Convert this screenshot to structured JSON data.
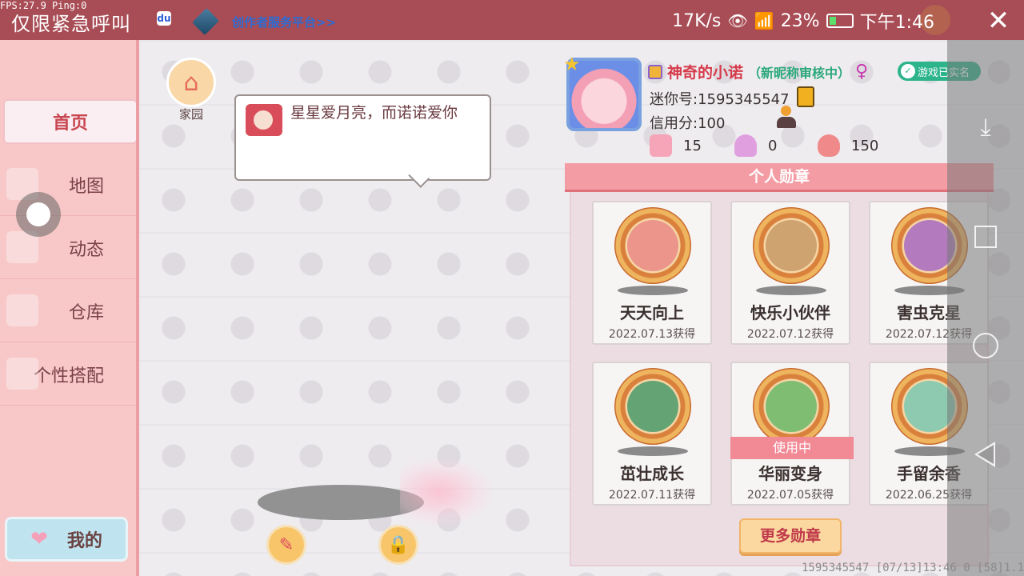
{
  "statusbar": {
    "fps": "FPS:27.9  Ping:0",
    "urgent": "仅限紧急呼叫",
    "creator": "创作者服务平台>>",
    "net_speed": "17K/s",
    "battery_pct": "23%",
    "time": "下午1:46",
    "close_icon": "close-icon"
  },
  "sidebar": {
    "items": [
      {
        "label": "首页"
      },
      {
        "label": "地图"
      },
      {
        "label": "动态"
      },
      {
        "label": "仓库"
      },
      {
        "label": "个性搭配"
      }
    ],
    "mine_label": "我的"
  },
  "home": {
    "label": "家园"
  },
  "bubble": {
    "text": "星星爱月亮，而诺诺爱你"
  },
  "profile": {
    "nickname": "神奇的小诺",
    "nickname_status": "（新昵称审核中）",
    "verified": "游戏已实名",
    "mini_id": "迷你号:1595345547",
    "credit": "信用分:100",
    "stats": [
      {
        "icon": "bookmark-plus-icon",
        "value": "15"
      },
      {
        "icon": "cheer-icon",
        "value": "0"
      },
      {
        "icon": "flame-icon",
        "value": "150"
      }
    ]
  },
  "medals": {
    "header": "个人勋章",
    "items": [
      {
        "name": "天天向上",
        "date": "2022.07.13获得",
        "color": "#e98a86"
      },
      {
        "name": "快乐小伙伴",
        "date": "2022.07.12获得",
        "color": "#c89a66"
      },
      {
        "name": "害虫克星",
        "date": "2022.07.12获得",
        "color": "#a86ac2"
      },
      {
        "name": "茁壮成长",
        "date": "2022.07.11获得",
        "color": "#4a9a6a"
      },
      {
        "name": "华丽变身",
        "date": "2022.07.05获得",
        "color": "#6ab86a",
        "badge": "使用中"
      },
      {
        "name": "手留余香",
        "date": "2022.06.25获得",
        "color": "#7ac8b0"
      }
    ],
    "more_label": "更多勋章"
  },
  "footer": {
    "text": "1595345547   [07/13]13:46 0  [58]1.15.0"
  }
}
